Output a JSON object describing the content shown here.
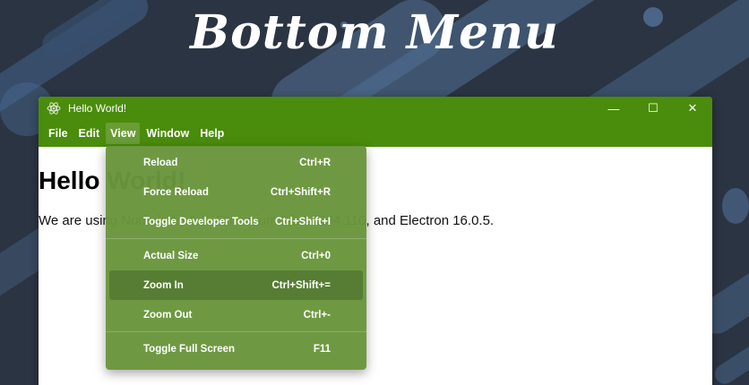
{
  "page": {
    "title": "Bottom Menu"
  },
  "window": {
    "title": "Hello World!",
    "controls": {
      "minimize": "—",
      "maximize": "☐",
      "close": "✕"
    },
    "accent": "#4a8c0b"
  },
  "menubar": {
    "items": [
      "File",
      "Edit",
      "View",
      "Window",
      "Help"
    ],
    "active": "View"
  },
  "content": {
    "heading": "Hello World!",
    "paragraph": "We are using Node.js 16.9.1, Chromium 96.0.4664.110, and Electron 16.0.5."
  },
  "view_menu": {
    "groups": [
      [
        {
          "label": "Reload",
          "shortcut": "Ctrl+R"
        },
        {
          "label": "Force Reload",
          "shortcut": "Ctrl+Shift+R"
        },
        {
          "label": "Toggle Developer Tools",
          "shortcut": "Ctrl+Shift+I"
        }
      ],
      [
        {
          "label": "Actual Size",
          "shortcut": "Ctrl+0"
        },
        {
          "label": "Zoom In",
          "shortcut": "Ctrl+Shift+=",
          "highlighted": true
        },
        {
          "label": "Zoom Out",
          "shortcut": "Ctrl+-"
        }
      ],
      [
        {
          "label": "Toggle Full Screen",
          "shortcut": "F11"
        }
      ]
    ]
  }
}
